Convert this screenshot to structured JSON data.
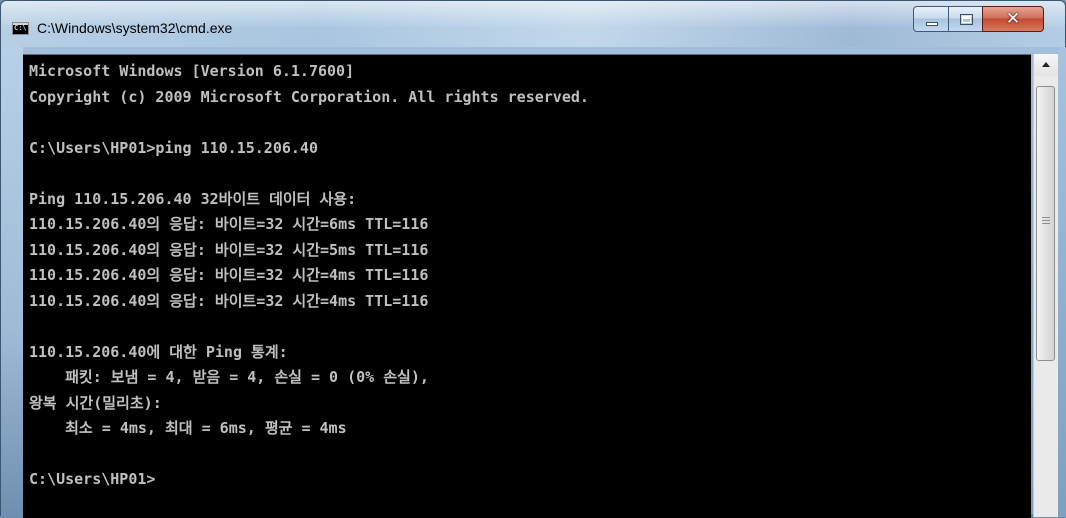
{
  "window": {
    "title": "C:\\Windows\\system32\\cmd.exe",
    "icon": "cmd-app-icon",
    "buttons": {
      "minimize": "minimize-icon",
      "maximize": "maximize-icon",
      "close": "close-icon"
    }
  },
  "console": {
    "lines": [
      "Microsoft Windows [Version 6.1.7600]",
      "Copyright (c) 2009 Microsoft Corporation. All rights reserved.",
      "",
      "C:\\Users\\HP01>ping 110.15.206.40",
      "",
      "Ping 110.15.206.40 32바이트 데이터 사용:",
      "110.15.206.40의 응답: 바이트=32 시간=6ms TTL=116",
      "110.15.206.40의 응답: 바이트=32 시간=5ms TTL=116",
      "110.15.206.40의 응답: 바이트=32 시간=4ms TTL=116",
      "110.15.206.40의 응답: 바이트=32 시간=4ms TTL=116",
      "",
      "110.15.206.40에 대한 Ping 통계:",
      "    패킷: 보냄 = 4, 받음 = 4, 손실 = 0 (0% 손실),",
      "왕복 시간(밀리초):",
      "    최소 = 4ms, 최대 = 6ms, 평균 = 4ms",
      "",
      "C:\\Users\\HP01>"
    ]
  },
  "colors": {
    "console_bg": "#000000",
    "console_fg": "#c0c0c0",
    "close_button": "#c24a30"
  }
}
